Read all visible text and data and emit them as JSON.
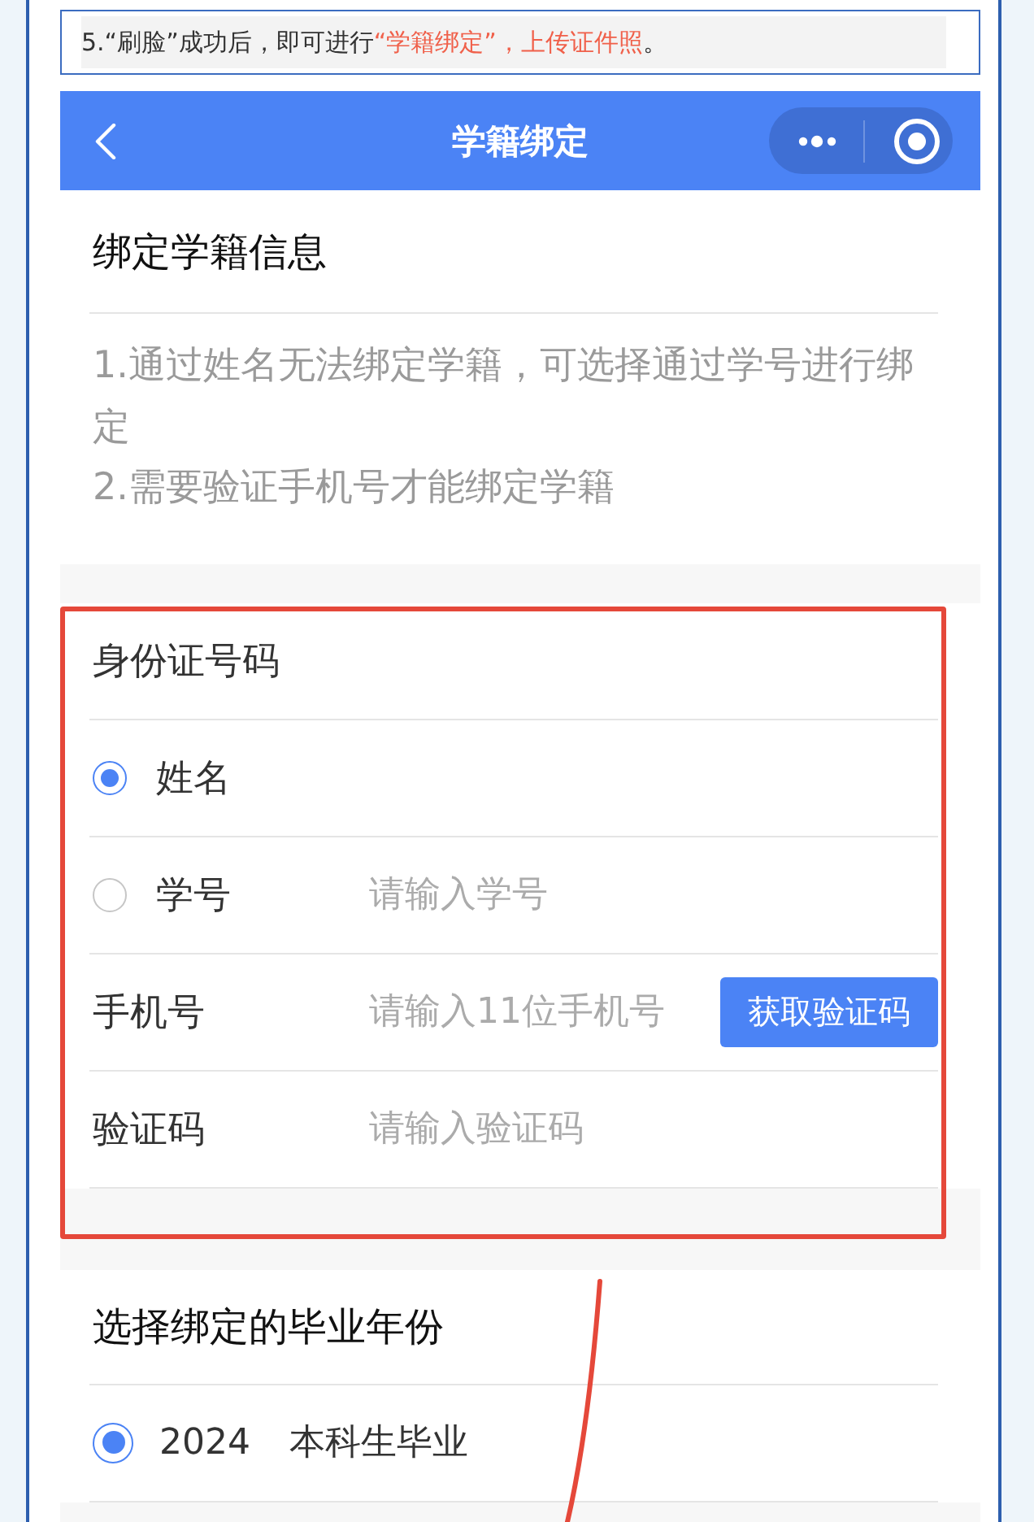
{
  "caption": {
    "segments": [
      {
        "text": "5.“刷脸”成功后，即可进行",
        "kind": "normal"
      },
      {
        "text": "“学籍绑定”，上传证件照",
        "kind": "emphasis"
      },
      {
        "text": "。",
        "kind": "normal"
      }
    ]
  },
  "nav": {
    "title": "学籍绑定"
  },
  "info": {
    "title": "绑定学籍信息",
    "notes": [
      "1.通过姓名无法绑定学籍，可选择通过学号进行绑定",
      "2.需要验证手机号才能绑定学籍"
    ]
  },
  "form": {
    "rows": [
      {
        "kind": "field",
        "label": "身份证号码"
      },
      {
        "kind": "radio",
        "label": "姓名",
        "selected": true
      },
      {
        "kind": "radio",
        "label": "学号",
        "selected": false,
        "placeholder": "请输入学号"
      },
      {
        "kind": "field",
        "label": "手机号",
        "placeholder": "请输入11位手机号",
        "button": "获取验证码"
      },
      {
        "kind": "field",
        "label": "验证码",
        "placeholder": "请输入验证码"
      }
    ]
  },
  "graduation": {
    "title": "选择绑定的毕业年份",
    "options": [
      {
        "year": "2024",
        "label": "本科生毕业",
        "selected": true
      }
    ]
  }
}
